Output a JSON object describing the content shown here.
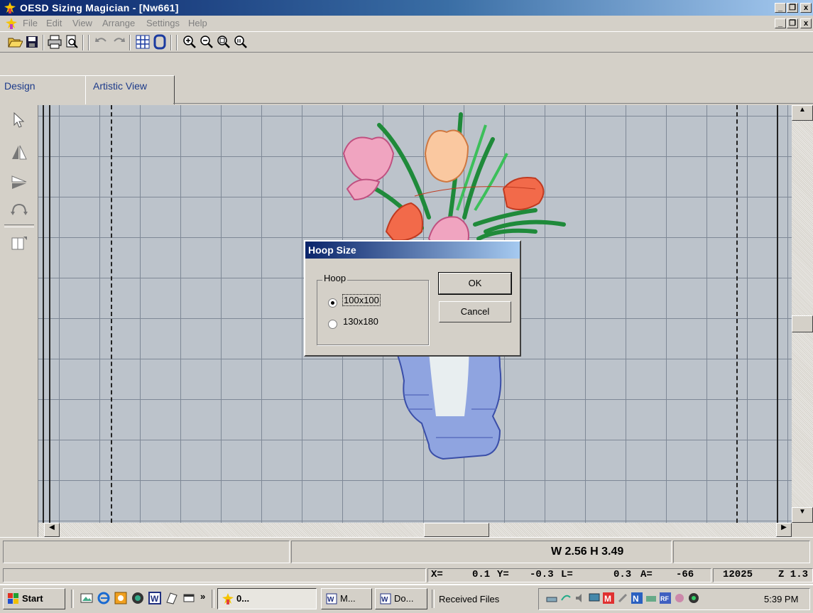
{
  "window": {
    "title": "OESD Sizing Magician - [Nw661]",
    "controls": {
      "minimize": "_",
      "restore": "❐",
      "close": "x"
    }
  },
  "menu": [
    "File",
    "Edit",
    "View",
    "Arrange",
    "Settings",
    "Help"
  ],
  "toolbar": {
    "icons": [
      "open-folder-icon",
      "save-icon",
      "print-icon",
      "print-preview-icon",
      "undo-icon",
      "redo-icon",
      "grid-icon",
      "hoop-icon",
      "zoom-in-icon",
      "zoom-out-icon",
      "zoom-fit-icon",
      "zoom-100-icon"
    ]
  },
  "tabs": {
    "design": "Design",
    "artistic": "Artistic View"
  },
  "palette": [
    "select-arrow-icon",
    "mirror-horizontal-icon",
    "mirror-vertical-icon",
    "rotate-icon",
    "resize-icon"
  ],
  "dialog": {
    "title": "Hoop Size",
    "group_label": "Hoop",
    "options": [
      "100x100",
      "130x180"
    ],
    "selected": "100x100",
    "ok": "OK",
    "cancel": "Cancel"
  },
  "status": {
    "size": "W 2.56 H 3.49",
    "x_label": "X=",
    "x_value": "0.1",
    "y_label": "Y=",
    "y_value": "-0.3",
    "l_label": "L=",
    "l_value": "0.3",
    "a_label": "A=",
    "a_value": "-66",
    "stitches": "12025",
    "zoom": "Z 1.3"
  },
  "taskbar": {
    "start": "Start",
    "chevron": "»",
    "tasks": [
      "0...",
      "M...",
      "Do..."
    ],
    "received": "Received Files",
    "clock": "5:39 PM"
  },
  "colors": {
    "canvas": "#bcc3cb",
    "grid": "#7e8896",
    "title_bar": "#0a246a",
    "tab_text": "#1c3a8a"
  }
}
